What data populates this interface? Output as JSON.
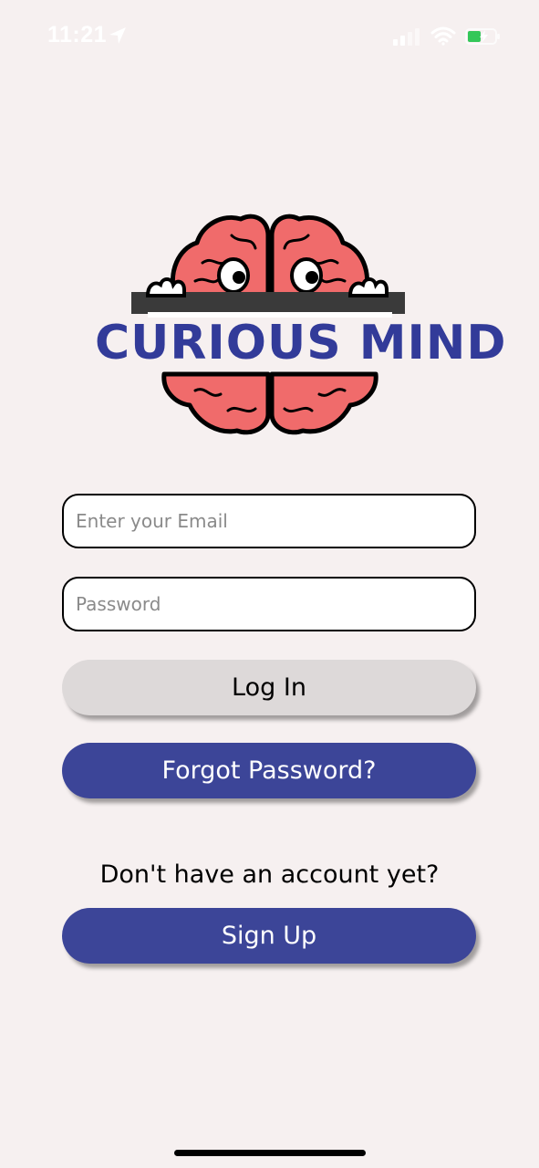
{
  "status_bar": {
    "time": "11:21",
    "icons": [
      "location-arrow-icon",
      "cellular-signal-icon",
      "wifi-icon",
      "battery-charging-icon"
    ],
    "battery_color": "#34c759"
  },
  "logo": {
    "text": "CURIOUS MIND",
    "brain_color": "#f06b6b",
    "text_color": "#323b99"
  },
  "login_form": {
    "email_placeholder": "Enter your Email",
    "email_value": "",
    "password_placeholder": "Password",
    "password_value": "",
    "login_label": "Log In",
    "forgot_label": "Forgot Password?"
  },
  "signup": {
    "prompt": "Don't have an account yet?",
    "button_label": "Sign Up"
  },
  "colors": {
    "background": "#f6f0f0",
    "primary": "#3c4598",
    "secondary_button": "#ddd9d9"
  }
}
